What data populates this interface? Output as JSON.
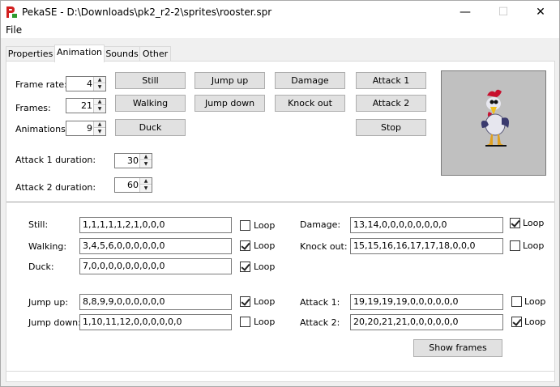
{
  "window": {
    "title": "PekaSE - D:\\Downloads\\pk2_r2-2\\sprites\\rooster.spr",
    "minimize_glyph": "—",
    "maximize_glyph": "☐",
    "close_glyph": "✕"
  },
  "menu": {
    "file": "File"
  },
  "tabs": [
    "Properties",
    "Animation",
    "Sounds",
    "Other"
  ],
  "active_tab": "Animation",
  "settings": {
    "frame_rate_label": "Frame rate:",
    "frame_rate": "4",
    "frames_label": "Frames:",
    "frames": "21",
    "animations_label": "Animations:",
    "animations": "9",
    "attack1_duration_label": "Attack 1 duration:",
    "attack1_duration": "30",
    "attack2_duration_label": "Attack 2 duration:",
    "attack2_duration": "60"
  },
  "preview_buttons": {
    "still": "Still",
    "jump_up": "Jump up",
    "damage": "Damage",
    "attack1": "Attack 1",
    "walking": "Walking",
    "jump_down": "Jump down",
    "knock_out": "Knock out",
    "attack2": "Attack 2",
    "duck": "Duck",
    "stop": "Stop"
  },
  "loop_label": "Loop",
  "animations": {
    "still": {
      "label": "Still:",
      "frames": "1,1,1,1,1,2,1,0,0,0",
      "loop": false
    },
    "walking": {
      "label": "Walking:",
      "frames": "3,4,5,6,0,0,0,0,0,0",
      "loop": true
    },
    "duck": {
      "label": "Duck:",
      "frames": "7,0,0,0,0,0,0,0,0,0",
      "loop": true
    },
    "jump_up": {
      "label": "Jump up:",
      "frames": "8,8,9,9,0,0,0,0,0,0",
      "loop": true
    },
    "jump_down": {
      "label": "Jump down:",
      "frames": "1,10,11,12,0,0,0,0,0,0",
      "loop": false
    },
    "damage": {
      "label": "Damage:",
      "frames": "13,14,0,0,0,0,0,0,0,0",
      "loop": true
    },
    "knock_out": {
      "label": "Knock out:",
      "frames": "15,15,16,16,17,17,18,0,0,0",
      "loop": false
    },
    "attack1": {
      "label": "Attack 1:",
      "frames": "19,19,19,19,0,0,0,0,0,0",
      "loop": false
    },
    "attack2": {
      "label": "Attack 2:",
      "frames": "20,20,21,21,0,0,0,0,0,0",
      "loop": true
    }
  },
  "show_frames": "Show frames",
  "colors": {
    "app_icon_red": "#d21f1f",
    "app_icon_green": "#2e9b2e"
  }
}
